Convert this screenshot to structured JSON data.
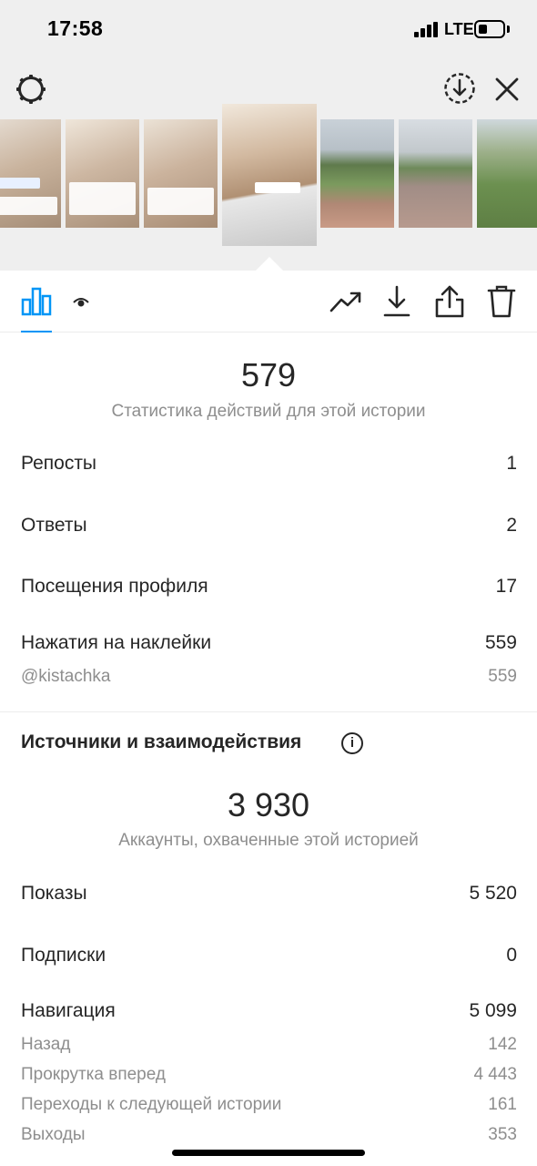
{
  "status_bar": {
    "time": "17:58",
    "network": "LTE",
    "battery_level": 0.35
  },
  "header": {
    "settings_icon": "gear-icon",
    "download_icon": "download-circle-icon",
    "close_icon": "close-icon"
  },
  "thumbnails": [
    {
      "name": "story-thumb-1",
      "bg": "#cbb8a5"
    },
    {
      "name": "story-thumb-2",
      "bg": "#c9b59f"
    },
    {
      "name": "story-thumb-3",
      "bg": "#c7b39e"
    },
    {
      "name": "story-thumb-4-selected",
      "bg": "#c6ae96"
    },
    {
      "name": "story-thumb-5",
      "bg": "#7f8f73"
    },
    {
      "name": "story-thumb-6",
      "bg": "#8f8f86"
    },
    {
      "name": "story-thumb-7",
      "bg": "#6f8e5a"
    }
  ],
  "tabs": {
    "active": "insights-chart-icon",
    "viewers": "eye-icon"
  },
  "actions": [
    "trend-icon",
    "download-icon",
    "share-icon",
    "trash-icon"
  ],
  "interactions": {
    "total": "579",
    "caption": "Статистика действий для этой истории",
    "rows": [
      {
        "label": "Репосты",
        "value": "1"
      },
      {
        "label": "Ответы",
        "value": "2"
      },
      {
        "label": "Посещения профиля",
        "value": "17"
      },
      {
        "label": "Нажатия на наклейки",
        "value": "559"
      }
    ],
    "sticker": {
      "label": "@kistachka",
      "value": "559"
    }
  },
  "discovery": {
    "title": "Источники и взаимодействия",
    "reach": "3 930",
    "reach_caption": "Аккаунты, охваченные этой историей",
    "rows": [
      {
        "label": "Показы",
        "value": "5 520"
      },
      {
        "label": "Подписки",
        "value": "0"
      },
      {
        "label": "Навигация",
        "value": "5 099"
      }
    ],
    "navigation": [
      {
        "label": "Назад",
        "value": "142"
      },
      {
        "label": "Прокрутка вперед",
        "value": "4 443"
      },
      {
        "label": "Переходы к следующей истории",
        "value": "161"
      },
      {
        "label": "Выходы",
        "value": "353"
      }
    ]
  },
  "colors": {
    "accent": "#0095f6",
    "text": "#262626",
    "muted": "#8e8e8e",
    "header_bg": "#efefef"
  }
}
